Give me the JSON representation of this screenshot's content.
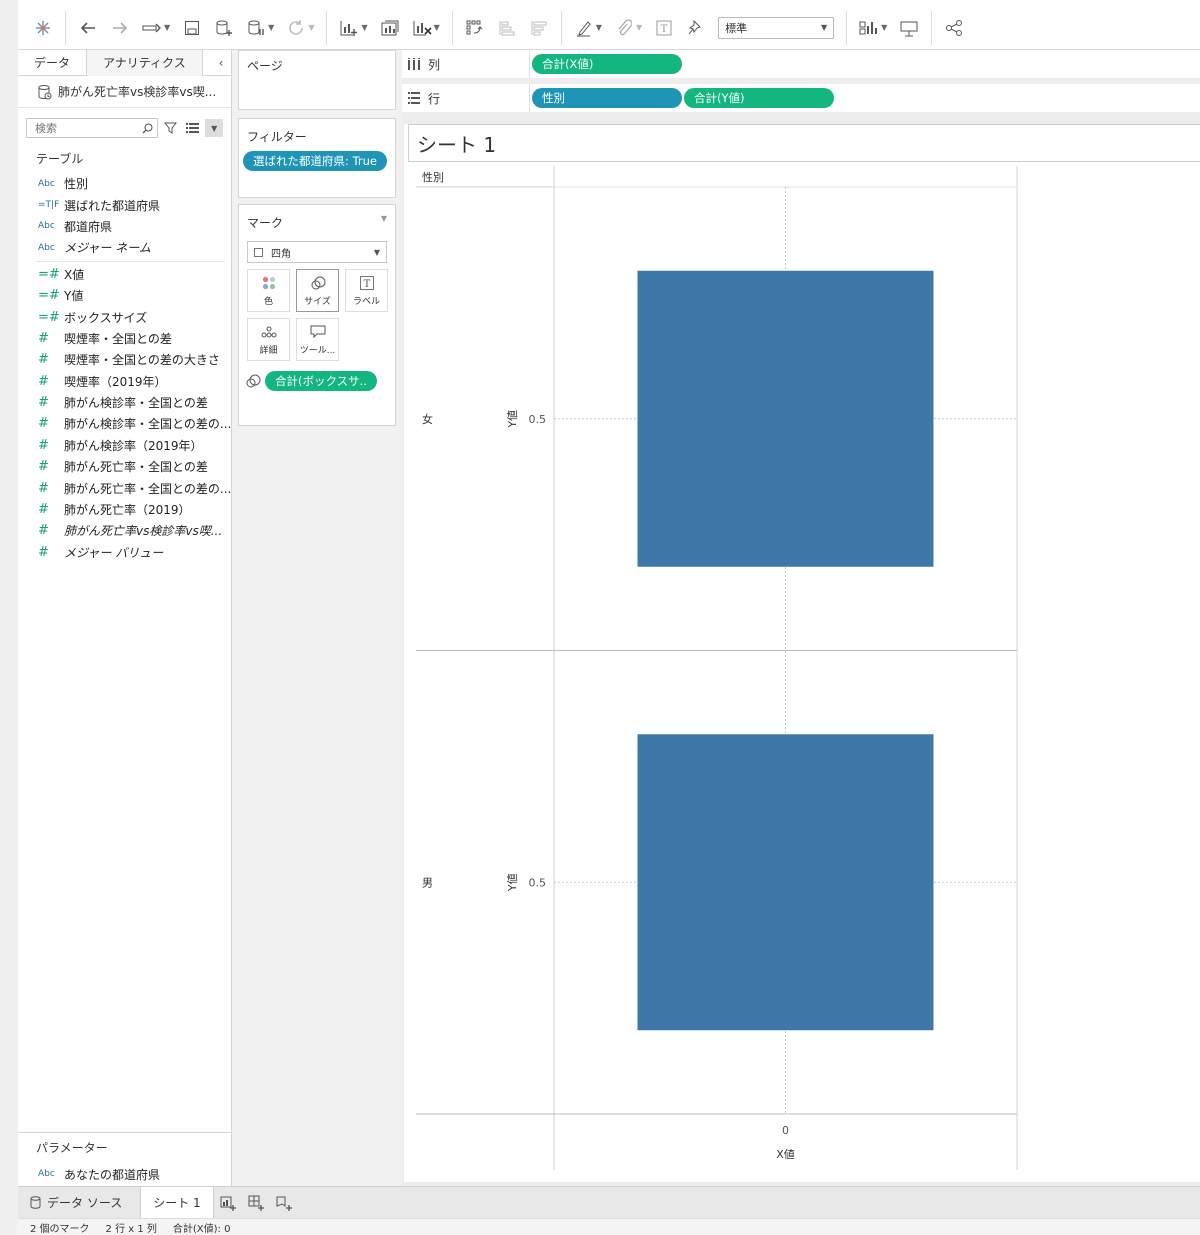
{
  "toolbar": {
    "format_select": "標準"
  },
  "data_pane": {
    "tabs": [
      "データ",
      "アナリティクス"
    ],
    "datasource": "肺がん死亡率vs検診率vs喫...",
    "search_placeholder": "検索",
    "tables_title": "テーブル",
    "fields": [
      {
        "type": "Abc",
        "kind": "dim",
        "name": "性別"
      },
      {
        "type": "=T|F",
        "kind": "dim",
        "name": "選ばれた都道府県"
      },
      {
        "type": "Abc",
        "kind": "dim",
        "name": "都道府県"
      },
      {
        "type": "Abc",
        "kind": "dim",
        "name": "メジャー ネーム",
        "italic": true
      }
    ],
    "measures": [
      {
        "type": "=#",
        "name": "X値"
      },
      {
        "type": "=#",
        "name": "Y値"
      },
      {
        "type": "=#",
        "name": "ボックスサイズ"
      },
      {
        "type": "#",
        "name": "喫煙率・全国との差"
      },
      {
        "type": "#",
        "name": "喫煙率・全国との差の大きさ"
      },
      {
        "type": "#",
        "name": "喫煙率（2019年）"
      },
      {
        "type": "#",
        "name": "肺がん検診率・全国との差"
      },
      {
        "type": "#",
        "name": "肺がん検診率・全国との差の..."
      },
      {
        "type": "#",
        "name": "肺がん検診率（2019年）"
      },
      {
        "type": "#",
        "name": "肺がん死亡率・全国との差"
      },
      {
        "type": "#",
        "name": "肺がん死亡率・全国との差の..."
      },
      {
        "type": "#",
        "name": "肺がん死亡率（2019）"
      },
      {
        "type": "#",
        "name": "肺がん死亡率vs検診率vs喫...",
        "italic": true
      },
      {
        "type": "#",
        "name": "メジャー バリュー",
        "italic": true
      }
    ],
    "params_title": "パラメーター",
    "param": {
      "type": "Abc",
      "name": "あなたの都道府県"
    }
  },
  "shelves": {
    "pages_title": "ページ",
    "filters_title": "フィルター",
    "filter_pill": "選ばれた都道府県: True",
    "marks_title": "マーク",
    "mark_type": "四角",
    "mark_buttons": [
      "色",
      "サイズ",
      "ラベル",
      "詳細",
      "ツール..."
    ],
    "size_pill": "合計(ボックスサ..",
    "columns_label": "列",
    "rows_label": "行",
    "column_pills": [
      "合計(X値)"
    ],
    "row_pills": [
      "性別",
      "合計(Y値)"
    ]
  },
  "viz": {
    "sheet_title": "シート 1",
    "row_header_title": "性別",
    "x_axis_label": "X値",
    "x_tick": "0"
  },
  "chart_data": {
    "type": "scatter",
    "mark": "square",
    "facet": "性別",
    "categories": [
      "女",
      "男"
    ],
    "x": [
      0,
      0
    ],
    "y": [
      0.5,
      0.5
    ],
    "xlabel": "X値",
    "ylabel": "Y値",
    "x_ticks": [
      "0"
    ],
    "y_ticks": [
      "0.5"
    ],
    "color": "#3e78a9",
    "grid": true
  },
  "sheet_tabs": {
    "datasource_tab": "データ ソース",
    "sheet_tab": "シート 1"
  },
  "status": {
    "marks": "2 個のマーク",
    "dims": "2 行 x 1 列",
    "sum": "合計(X値): 0"
  }
}
